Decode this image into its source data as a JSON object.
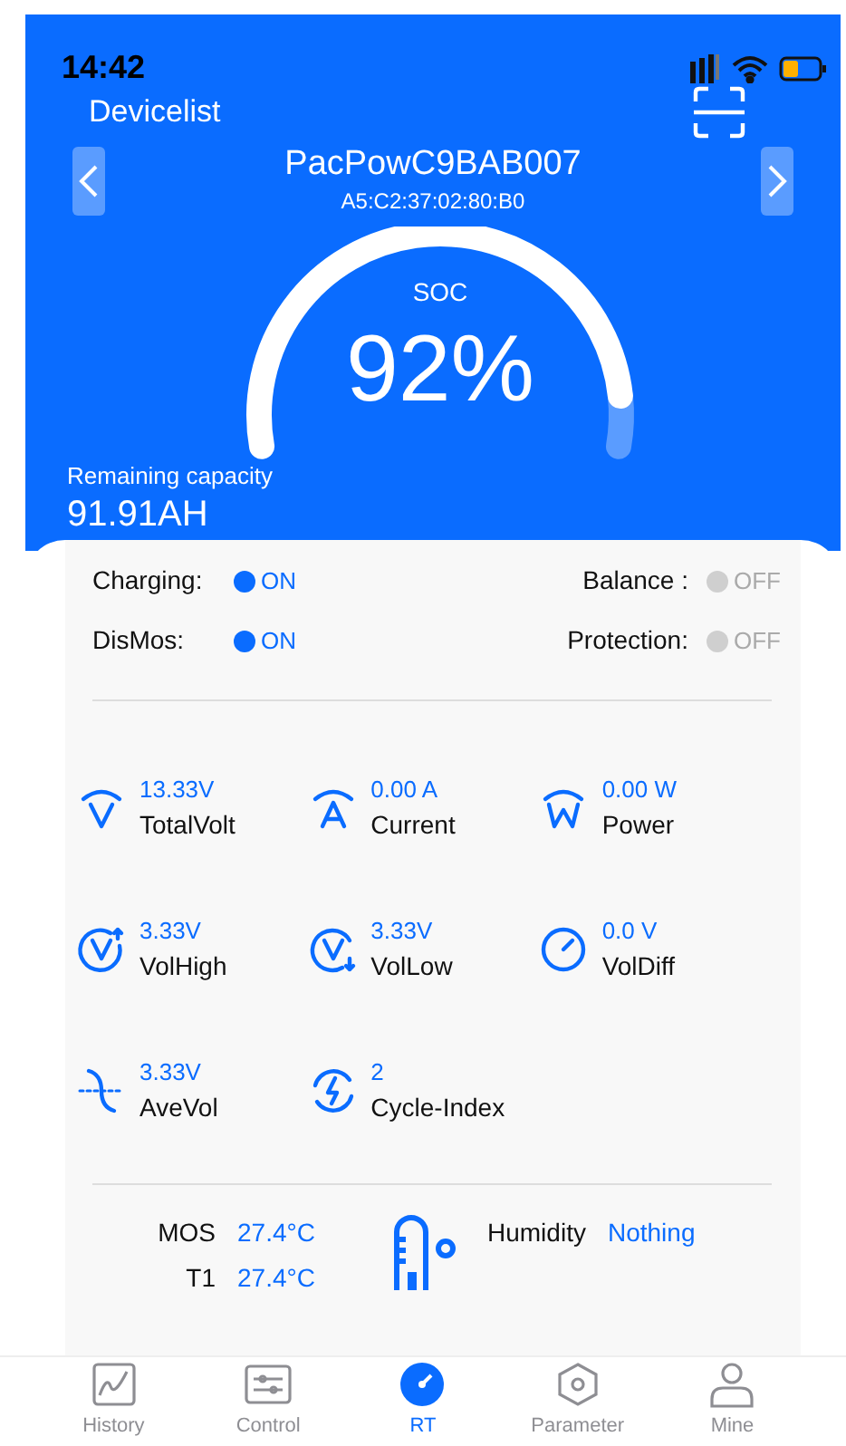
{
  "status_bar": {
    "time": "14:42"
  },
  "header": {
    "back_label": "Devicelist",
    "device_name": "PacPowC9BAB007",
    "device_address": "A5:C2:37:02:80:B0"
  },
  "gauge": {
    "label": "SOC",
    "reading": "92%"
  },
  "remaining": {
    "label": "Remaining capacity",
    "value": "91.91AH"
  },
  "switches": [
    {
      "label": "Charging:",
      "state": "ON",
      "on": true
    },
    {
      "label": "Balance :",
      "state": "OFF",
      "on": false
    },
    {
      "label": "DisMos:",
      "state": "ON",
      "on": true
    },
    {
      "label": "Protection:",
      "state": "OFF",
      "on": false
    }
  ],
  "metrics": [
    {
      "kind": "volt",
      "value": "13.33V",
      "label": "TotalVolt"
    },
    {
      "kind": "current",
      "value": "0.00 A",
      "label": "Current"
    },
    {
      "kind": "power",
      "value": "0.00 W",
      "label": "Power"
    },
    {
      "kind": "high",
      "value": "3.33V",
      "label": "VolHigh"
    },
    {
      "kind": "low",
      "value": "3.33V",
      "label": "VolLow"
    },
    {
      "kind": "diff",
      "value": "0.0 V",
      "label": "VolDiff"
    },
    {
      "kind": "average",
      "value": "3.33V",
      "label": "AveVol"
    },
    {
      "kind": "cycle",
      "value": "2",
      "label": "Cycle-Index"
    }
  ],
  "temperatures": [
    {
      "label": "MOS",
      "value": "27.4°C"
    },
    {
      "label": "T1",
      "value": "27.4°C"
    }
  ],
  "humidity": {
    "label": "Humidity",
    "value": "Nothing"
  },
  "tabs": [
    {
      "kind": "history",
      "label": "History",
      "selected": false
    },
    {
      "kind": "control",
      "label": "Control",
      "selected": false
    },
    {
      "kind": "rt",
      "label": "RT",
      "selected": true
    },
    {
      "kind": "parameter",
      "label": "Parameter",
      "selected": false
    },
    {
      "kind": "mine",
      "label": "Mine",
      "selected": false
    }
  ]
}
